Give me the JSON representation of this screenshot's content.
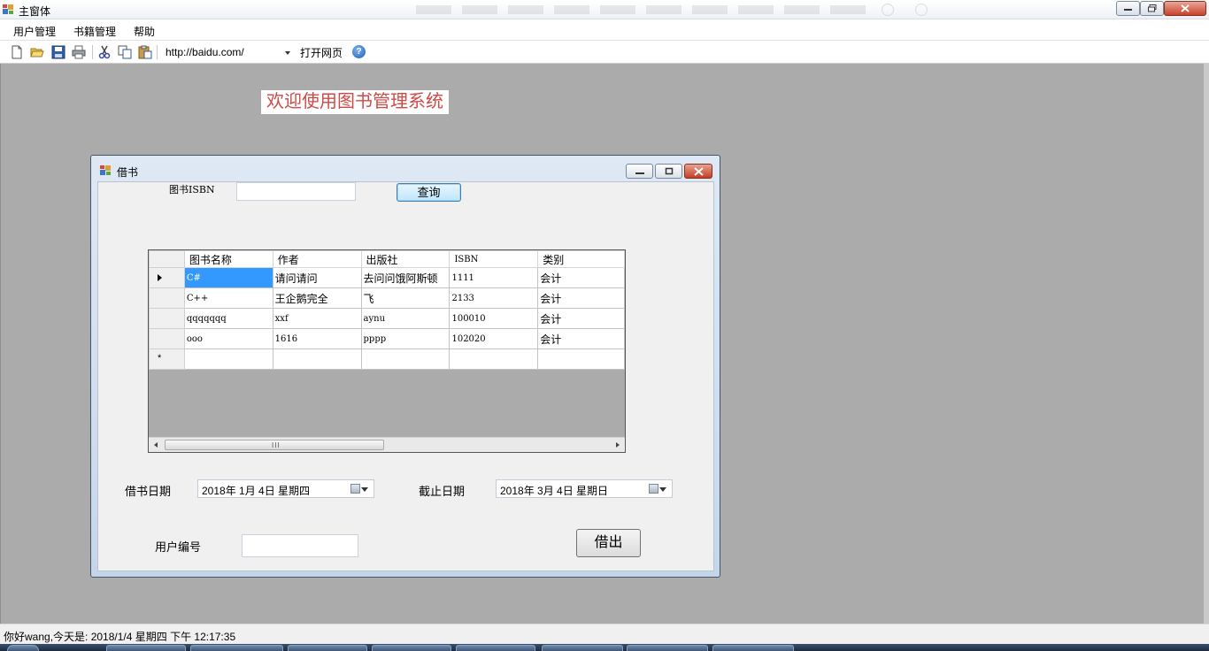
{
  "main_window": {
    "title": "主窗体"
  },
  "menu": {
    "items": [
      "用户管理",
      "书籍管理",
      "帮助"
    ]
  },
  "toolbar": {
    "icons": [
      "new-icon",
      "open-folder-icon",
      "save-icon",
      "print-icon",
      "cut-icon",
      "copy-icon",
      "paste-icon"
    ],
    "url": "http://baidu.com/",
    "open_web_label": "打开网页",
    "help_icon": "?"
  },
  "welcome_text": "欢迎使用图书管理系统",
  "borrow_window": {
    "title": "借书",
    "isbn_label": "图书ISBN",
    "isbn_value": "",
    "query_button": "查询",
    "grid": {
      "columns": [
        "图书名称",
        "作者",
        "出版社",
        "ISBN",
        "类别"
      ],
      "rows": [
        [
          "C#",
          "请问请问",
          "去问问饿阿斯顿",
          "1111",
          "会计"
        ],
        [
          "C++",
          "王企鹅完全",
          "飞",
          "2133",
          "会计"
        ],
        [
          "qqqqqqq",
          "xxf",
          "aynu",
          "100010",
          "会计"
        ],
        [
          "ooo",
          "1616",
          "pppp",
          "102020",
          "会计"
        ]
      ],
      "new_row_marker": "*",
      "scroll_grip": "III"
    },
    "borrow_date_label": "借书日期",
    "borrow_date_value": "2018年 1月 4日 星期四",
    "due_date_label": "截止日期",
    "due_date_value": "2018年 3月 4日 星期日",
    "user_id_label": "用户编号",
    "user_id_value": "",
    "borrow_button": "借出"
  },
  "status_bar": {
    "text": "你好wang,今天是:  2018/1/4 星期四 下午 12:17:35"
  },
  "colors": {
    "welcome_text": "#cf4a46",
    "selection": "#3399ff",
    "mdi_background": "#ababab"
  }
}
